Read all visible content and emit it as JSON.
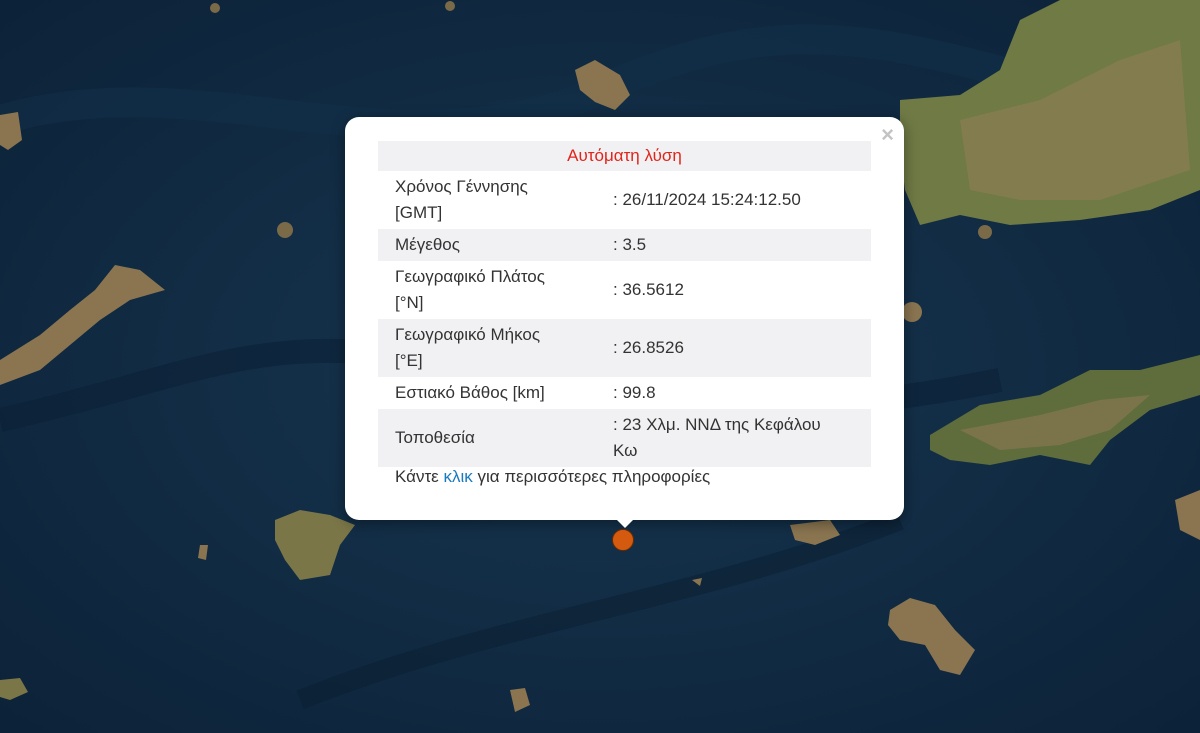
{
  "popup": {
    "header": "Αυτόματη λύση",
    "close_label": "×",
    "rows": [
      {
        "label_line1": "Χρόνος Γέννησης",
        "label_line2": "[GMT]",
        "value": ": 26/11/2024 15:24:12.50"
      },
      {
        "label_line1": "Μέγεθος",
        "label_line2": "",
        "value": ": 3.5"
      },
      {
        "label_line1": "Γεωγραφικό Πλάτος",
        "label_line2": "[°N]",
        "value": ": 36.5612"
      },
      {
        "label_line1": "Γεωγραφικό Μήκος",
        "label_line2": "[°E]",
        "value": ": 26.8526"
      },
      {
        "label_line1": "Εστιακό Βάθος [km]",
        "label_line2": "",
        "value": ": 99.8"
      },
      {
        "label_line1": "Τοποθεσία",
        "label_line2": "",
        "value_line1": ": 23 Χλμ. ΝΝΔ της Κεφάλου",
        "value_line2": "Κω"
      }
    ],
    "more_prefix": "Κάντε ",
    "more_link": "κλικ",
    "more_suffix": " για περισσότερες πληροφορίες"
  },
  "colors": {
    "sea": "#0f2a42",
    "land": "#8a7550",
    "header_text": "#e0251b",
    "link": "#1a7ac0",
    "marker": "#d45a10"
  },
  "marker": {
    "icon": "earthquake-epicenter-marker"
  }
}
